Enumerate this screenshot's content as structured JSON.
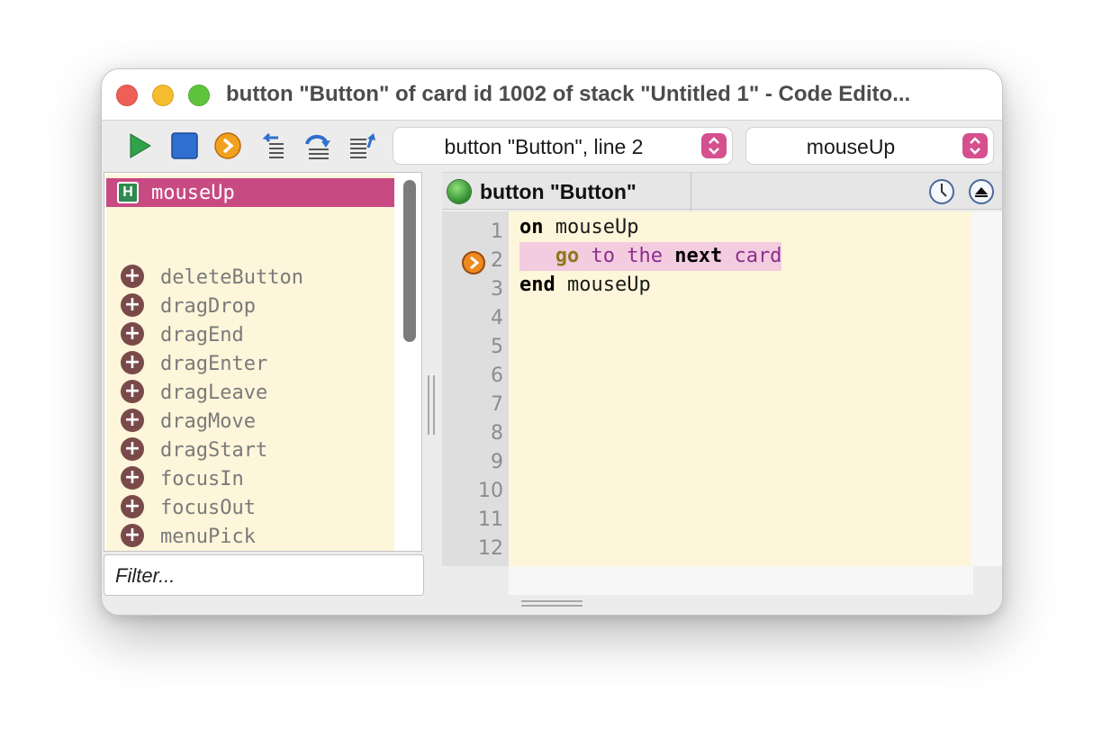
{
  "window": {
    "title": "button \"Button\" of card id 1002 of stack \"Untitled 1\" - Code Edito..."
  },
  "toolbar": {
    "icons": [
      "run-icon",
      "stop-icon",
      "step-into-icon",
      "step-out-icon",
      "step-over-icon",
      "format-icon"
    ],
    "handler_select": "button \"Button\", line 2",
    "message_select": "mouseUp"
  },
  "handlers": {
    "selected": {
      "icon_letter": "H",
      "label": "mouseUp"
    },
    "messages": [
      "deleteButton",
      "dragDrop",
      "dragEnd",
      "dragEnter",
      "dragLeave",
      "dragMove",
      "dragStart",
      "focusIn",
      "focusOut",
      "menuPick"
    ]
  },
  "filter": {
    "placeholder": "Filter..."
  },
  "editor": {
    "header_title": "button \"Button\"",
    "line_numbers": [
      "1",
      "2",
      "3",
      "4",
      "5",
      "6",
      "7",
      "8",
      "9",
      "10",
      "11",
      "12"
    ],
    "code": {
      "line1_kw": "on",
      "line1_name": " mouseUp",
      "line2_indent": "   ",
      "line2_go": "go",
      "line2_mid": " to the ",
      "line2_next": "next",
      "line2_card": " card",
      "line3_kw": "end",
      "line3_name": " mouseUp"
    }
  },
  "colors": {
    "accent": "#c84a82",
    "list_background": "#fdf6da",
    "highlight": "#f4cce0"
  }
}
